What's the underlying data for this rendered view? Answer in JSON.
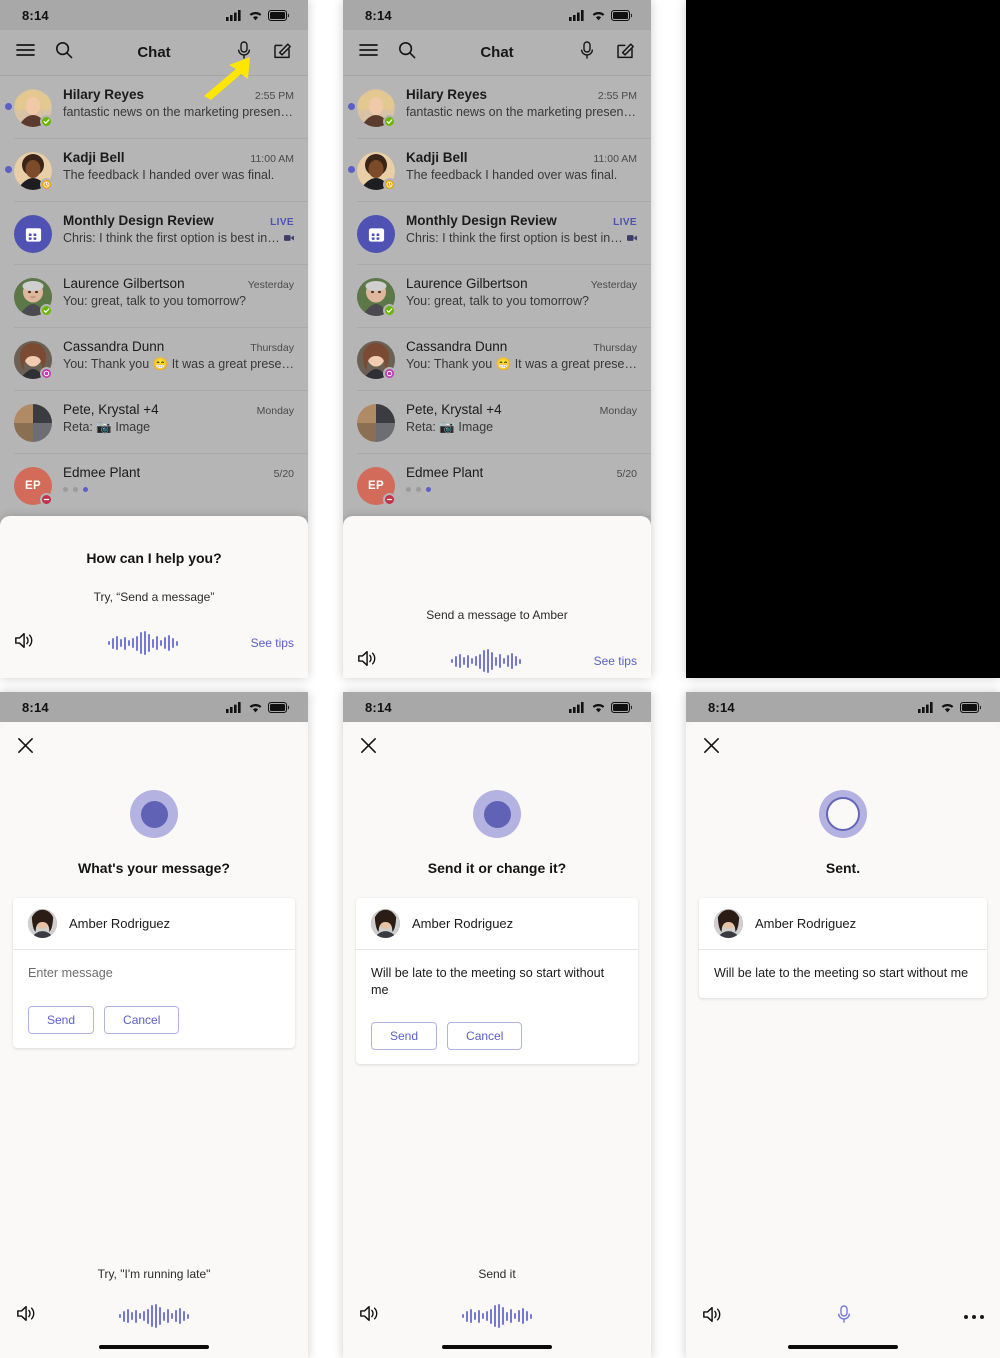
{
  "status_bar": {
    "time": "8:14",
    "icons": [
      "cellular-signal-icon",
      "wifi-icon",
      "battery-icon"
    ]
  },
  "chat_screen": {
    "app_bar": {
      "title": "Chat",
      "menu_icon": "hamburger-menu-icon",
      "search_icon": "search-icon",
      "mic_icon": "microphone-icon",
      "compose_icon": "compose-icon"
    },
    "rows": [
      {
        "name": "Hilary Reyes",
        "preview": "fantastic news on the marketing presen…",
        "time": "2:55 PM",
        "unread": true,
        "presence": "available",
        "bold": true
      },
      {
        "name": "Kadji Bell",
        "preview": "The feedback I handed over was final.",
        "time": "11:00 AM",
        "unread": true,
        "presence": "away",
        "bold": true
      },
      {
        "name": "Monthly Design Review",
        "preview": "Chris: I think the first option is best in…",
        "time": "LIVE",
        "live": true,
        "unread": false,
        "presence": "none",
        "bold": true,
        "group": true,
        "video_icon": "video-camera-icon"
      },
      {
        "name": "Laurence Gilbertson",
        "preview": "You: great, talk to you tomorrow?",
        "time": "Yesterday",
        "unread": false,
        "presence": "available",
        "bold": false
      },
      {
        "name": "Cassandra Dunn",
        "preview": "You: Thank you 😁 It was a great prese…",
        "time": "Thursday",
        "unread": false,
        "presence": "oof",
        "bold": false
      },
      {
        "name": "Pete, Krystal +4",
        "preview": "Reta: 📷 Image",
        "time": "Monday",
        "unread": false,
        "presence": "none",
        "bold": false,
        "grid": true
      },
      {
        "name": "Edmee Plant",
        "preview": "",
        "time": "5/20",
        "unread": false,
        "presence": "dnd",
        "bold": false,
        "initials": "EP",
        "typing": true
      }
    ]
  },
  "voice_sheet_1": {
    "title": "How can I help you?",
    "subtitle": "Try, “Send a message”",
    "speaker_icon": "speaker-icon",
    "waveform_icon": "waveform-icon",
    "see_tips": "See tips"
  },
  "voice_sheet_2": {
    "title": "",
    "subtitle": "Send a message to Amber",
    "speaker_icon": "speaker-icon",
    "waveform_icon": "waveform-icon",
    "see_tips": "See tips"
  },
  "panel_3": {
    "note": ""
  },
  "assistant_compose": {
    "close_icon": "close-icon",
    "orb_icon": "assistant-orb-icon",
    "title": "What's your message?",
    "recipient": "Amber Rodriguez",
    "message_placeholder": "Enter message",
    "message_value": "",
    "send_label": "Send",
    "cancel_label": "Cancel",
    "hint": "Try, \"I'm running late\"",
    "speaker_icon": "speaker-icon",
    "waveform_icon": "waveform-icon"
  },
  "assistant_confirm": {
    "close_icon": "close-icon",
    "orb_icon": "assistant-orb-icon",
    "title": "Send it or change it?",
    "recipient": "Amber Rodriguez",
    "message_value": "Will be late to the meeting so start without me",
    "send_label": "Send",
    "cancel_label": "Cancel",
    "hint": "Send it",
    "speaker_icon": "speaker-icon",
    "waveform_icon": "waveform-icon"
  },
  "assistant_sent": {
    "close_icon": "close-icon",
    "orb_icon": "assistant-orb-ring-icon",
    "title": "Sent.",
    "recipient": "Amber Rodriguez",
    "message_value": "Will be late to the meeting so start without me",
    "hint": "",
    "speaker_icon": "speaker-icon",
    "mic_icon": "microphone-icon",
    "more_icon": "more-options-icon"
  },
  "annotation": {
    "arrow_icon": "yellow-arrow-pointer",
    "color": "#ffe600",
    "points_at": "microphone-icon"
  },
  "colors": {
    "accent": "#5b5fc7",
    "orb_outer": "#b4b2e0",
    "orb_inner": "#5f62b5",
    "available": "#6bb700",
    "away": "#eaa300",
    "dnd": "#c4314b",
    "oof": "#c239b3",
    "live": "#4f52b2",
    "sheet_bg": "#faf9f8",
    "status_bar": "#a8a8a8"
  }
}
